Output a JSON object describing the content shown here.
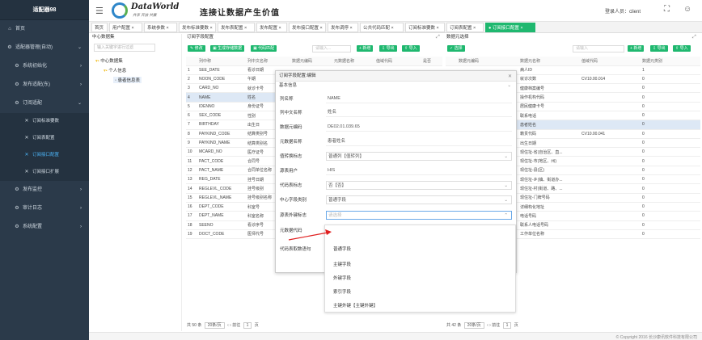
{
  "sidebar": {
    "brand": "适配器98",
    "items": [
      {
        "label": "首页",
        "icon": "home-icon",
        "glyph": "⌂"
      },
      {
        "label": "适配器管理(自动)",
        "icon": "settings-icon",
        "glyph": "⚙"
      },
      {
        "label": "系统初始化",
        "icon": "gear-icon",
        "glyph": "⚙"
      },
      {
        "label": "发布适配(东)",
        "icon": "gear-icon",
        "glyph": "⚙"
      },
      {
        "label": "订阅适配",
        "icon": "gear-icon",
        "glyph": "⚙"
      },
      {
        "label": "订阅标准要数",
        "icon": "wrench-icon",
        "glyph": "✕"
      },
      {
        "label": "订阅表配置",
        "icon": "wrench-icon",
        "glyph": "✕"
      },
      {
        "label": "订阅接口配置",
        "icon": "wrench-icon",
        "glyph": "✕"
      },
      {
        "label": "订阅接口扩展",
        "icon": "wrench-icon",
        "glyph": "✕"
      },
      {
        "label": "发布监控",
        "icon": "gear-icon",
        "glyph": "⚙"
      },
      {
        "label": "审计日志",
        "icon": "gear-icon",
        "glyph": "⚙"
      },
      {
        "label": "系统配置",
        "icon": "gear-icon",
        "glyph": "⚙"
      }
    ]
  },
  "header": {
    "logo_text": "DataWorld",
    "logo_sub": "共享 开放 共赢",
    "slogan": "连接让数据产生价值",
    "login_label": "登录人员：client"
  },
  "tabs": [
    "首页",
    "用户配置 ×",
    "系统参数 ×",
    "发布标准要数 ×",
    "发布表配置 ×",
    "发布配置 ×",
    "发布接口配置 ×",
    "发布调停 ×",
    "公共代码匹配 ×",
    "订阅标准要数 ×",
    "订阅表配置 ×",
    "● 订阅接口配置 ×"
  ],
  "left_panel": {
    "title": "中心数据集",
    "search_placeholder": "输入关键字进行过滤",
    "tree": [
      "中心数据集",
      "个人信息",
      "患者信息表"
    ]
  },
  "mid_panel": {
    "title": "订阅字段配置",
    "buttons": [
      "修改",
      "生成存储数据",
      "代码匹配"
    ],
    "columns": [
      "",
      "列中称",
      "列中文名称",
      "数据元编码",
      "元数据名称",
      "值域代码",
      "是否"
    ],
    "rows": [
      [
        "1",
        "SEE_DATE",
        "看诊日期",
        "",
        "",
        "",
        ""
      ],
      [
        "2",
        "NOON_CODE",
        "午期",
        "",
        "",
        "",
        ""
      ],
      [
        "3",
        "CARD_NO",
        "就诊卡号",
        "",
        "",
        "",
        ""
      ],
      [
        "4",
        "NAME",
        "姓名",
        "",
        "",
        "",
        ""
      ],
      [
        "5",
        "IDENNO",
        "身份证号",
        "",
        "",
        "",
        ""
      ],
      [
        "6",
        "SEX_CODE",
        "性别",
        "",
        "",
        "",
        ""
      ],
      [
        "7",
        "BIRTHDAY",
        "出生日",
        "",
        "",
        "",
        ""
      ],
      [
        "8",
        "PAYKIND_CODE",
        "结算类别号",
        "",
        "",
        "",
        ""
      ],
      [
        "9",
        "PAYKIND_NAME",
        "结算类别名",
        "",
        "",
        "",
        ""
      ],
      [
        "10",
        "MCARD_NO",
        "医疗证号",
        "",
        "",
        "",
        ""
      ],
      [
        "11",
        "PACT_CODE",
        "合同号",
        "",
        "",
        "",
        ""
      ],
      [
        "12",
        "PACT_NAME",
        "合同单位名称",
        "",
        "",
        "",
        ""
      ],
      [
        "13",
        "REG_DATE",
        "挂号日期",
        "",
        "",
        "",
        ""
      ],
      [
        "14",
        "REGLEVL_CODE",
        "挂号级别",
        "",
        "",
        "",
        ""
      ],
      [
        "15",
        "REGLEVL_NAME",
        "挂号级别名称",
        "",
        "",
        "",
        ""
      ],
      [
        "16",
        "DEPT_CODE",
        "科室号",
        "",
        "",
        "",
        ""
      ],
      [
        "17",
        "DEPT_NAME",
        "科室名称",
        "",
        "",
        "",
        ""
      ],
      [
        "18",
        "SEENO",
        "看诊序号",
        "",
        "",
        "",
        ""
      ],
      [
        "19",
        "DOCT_CODE",
        "医师代号",
        "",
        "",
        "",
        ""
      ]
    ],
    "pager": {
      "total": "共 50 条",
      "size": "20条/页",
      "goto": "前往",
      "page": "1",
      "unit": "页"
    },
    "search_placeholder": "请输入...",
    "add": "新增",
    "export": "导出",
    "import": "导入"
  },
  "right_panel": {
    "title": "数据元选择",
    "button": "选择",
    "search_placeholder": "请输入",
    "add": "新增",
    "export": "导出",
    "import": "导入",
    "columns": [
      "",
      "数据元编码",
      "数据元名称",
      "值域代码",
      "数据元类别"
    ],
    "rows": [
      [
        "",
        "",
        "病人ID",
        "",
        "1"
      ],
      [
        "",
        "",
        "就诊次数",
        "CV10.00.014",
        "0"
      ],
      [
        "",
        "",
        "健康档案编号",
        "",
        "0"
      ],
      [
        "",
        "",
        "操作机构代码",
        "",
        "0"
      ],
      [
        "",
        "",
        "居民健康卡号",
        "",
        "0"
      ],
      [
        "",
        "",
        "联系电话",
        "",
        "0"
      ],
      [
        "",
        "",
        "患者姓名",
        "",
        "0"
      ],
      [
        "",
        "",
        "籍贯代码",
        "CV10.00.041",
        "0"
      ],
      [
        "",
        "",
        "出生日期",
        "",
        "0"
      ],
      [
        "",
        "",
        "现住址-省(自治区、直...",
        "",
        "0"
      ],
      [
        "",
        "",
        "现住址-市(地区、州)",
        "",
        "0"
      ],
      [
        "",
        "",
        "现住址-县(区)",
        "",
        "0"
      ],
      [
        "",
        "",
        "现住址-乡(镇、街道办...",
        "",
        "0"
      ],
      [
        "",
        "",
        "现住址-村(街道、路、...",
        "",
        "0"
      ],
      [
        "",
        "",
        "现住址-门牌号码",
        "",
        "0"
      ],
      [
        "",
        "",
        "详细构化地址",
        "",
        "0"
      ],
      [
        "",
        "",
        "电话号码",
        "",
        "0"
      ],
      [
        "",
        "",
        "联系人电话号码",
        "",
        "0"
      ],
      [
        "",
        "",
        "工作单位名称",
        "",
        "0"
      ]
    ],
    "pager": {
      "total": "共 42 条",
      "size": "20条/页",
      "goto": "前往",
      "page": "1",
      "unit": "页"
    }
  },
  "dialog": {
    "title": "订阅字段配置:编辑",
    "section": "基本信息",
    "fields": [
      {
        "label": "列名称",
        "value": "NAME"
      },
      {
        "label": "列中文名称",
        "value": "姓名"
      },
      {
        "label": "数据元编码",
        "value": "DE02.01.039.65"
      },
      {
        "label": "元数据名称",
        "value": "患者姓名"
      },
      {
        "label": "值转换标志",
        "value": "普通列【值转列】"
      },
      {
        "label": "源表用户",
        "value": "HIS"
      },
      {
        "label": "代码表标志",
        "value": "否【否】"
      },
      {
        "label": "中心字段类别",
        "value": "普通字段"
      },
      {
        "label": "源表外键标志",
        "value": "请选择"
      },
      {
        "label": "元数据代码",
        "value": ""
      },
      {
        "label": "代码表取数语句",
        "value": ""
      }
    ],
    "dropdown": [
      "普通字段",
      "主键字段",
      "外键字段",
      "索引字段",
      "主键外键【主键外键】"
    ]
  },
  "footer": {
    "copyright": "© Copyright 2016 长沙康讯软件科技有限公司"
  }
}
